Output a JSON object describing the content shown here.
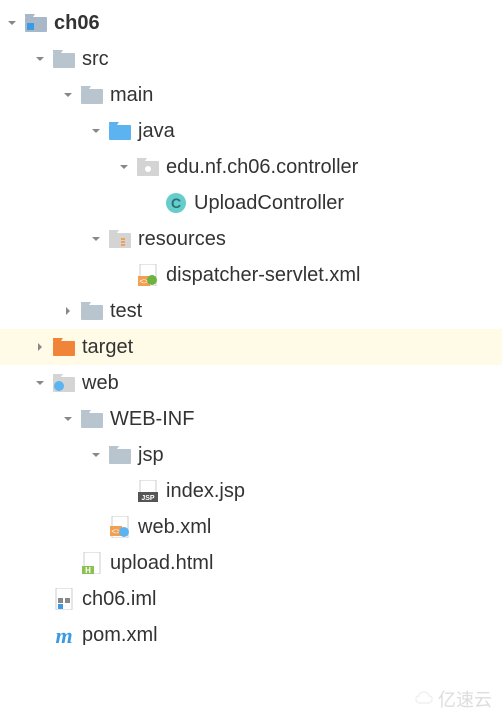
{
  "tree": {
    "ch06": "ch06",
    "src": "src",
    "main": "main",
    "java": "java",
    "package": "edu.nf.ch06.controller",
    "uploadController": "UploadController",
    "resources": "resources",
    "dispatcherServlet": "dispatcher-servlet.xml",
    "test": "test",
    "target": "target",
    "web": "web",
    "webinf": "WEB-INF",
    "jsp": "jsp",
    "indexJsp": "index.jsp",
    "webXml": "web.xml",
    "uploadHtml": "upload.html",
    "ch06Iml": "ch06.iml",
    "pomXml": "pom.xml"
  },
  "watermark": "亿速云"
}
